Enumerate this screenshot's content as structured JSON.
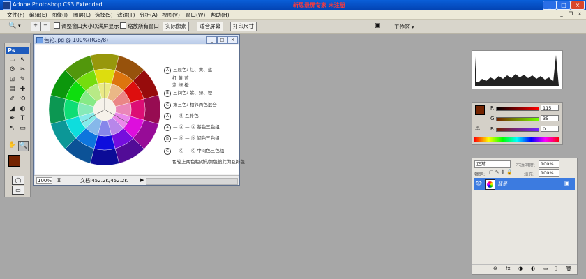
{
  "titlebar": {
    "title": "Adobe Photoshop CS3 Extended",
    "promo": "新思录屏专家 未注册",
    "min": "_",
    "max": "□",
    "close": "×"
  },
  "menu": [
    "文件(F)",
    "编辑(E)",
    "图像(I)",
    "图层(L)",
    "选择(S)",
    "滤镜(T)",
    "分析(A)",
    "视图(V)",
    "窗口(W)",
    "帮助(H)"
  ],
  "options": {
    "zoom_icon": "🔍",
    "dropdown": "▾",
    "resize_window": "调整窗口大小以满屏显示",
    "zoom_all": "缩放所有窗口",
    "actual_pixels": "实际像素",
    "fit_screen": "适合屏幕",
    "print_size": "打印尺寸",
    "workspace": "工作区 ▾"
  },
  "toolbox": {
    "logo": "Ps",
    "tools": [
      "▭",
      "↖",
      "ʘ",
      "✂",
      "⊡",
      "✎",
      "▤",
      "✚",
      "✐",
      "⟲",
      "◢",
      "◐",
      "✒",
      "T",
      "↖",
      "▭",
      "✋",
      "🔍"
    ]
  },
  "document": {
    "title": "色轮.jpg @ 100%(RGB/8)",
    "legend": [
      {
        "key": "A",
        "text": "三原色: 红、黄、蓝"
      },
      {
        "key": "",
        "text": "红  黄  蓝"
      },
      {
        "key": "",
        "text": "紫  绿  橙"
      },
      {
        "key": "B",
        "text": "三间色: 紫、绿、橙"
      },
      {
        "key": "C",
        "text": "第三色: 相邻两色混合"
      },
      {
        "key": "A",
        "text": "— Ⓑ  互补色"
      },
      {
        "key": "A",
        "text": "— Ⓐ — Ⓐ  基色三色组"
      },
      {
        "key": "B",
        "text": "— Ⓑ — Ⓑ  间色三色组"
      },
      {
        "key": "C",
        "text": "— Ⓒ — Ⓒ  中间色三色组"
      },
      {
        "key": "",
        "text": "色轮上两色相对的颜色彼此为互补色"
      }
    ],
    "zoom": "100%",
    "doc_size": "文档:452.2K/452.2K"
  },
  "color_panel": {
    "channels": [
      {
        "label": "R",
        "value": "115"
      },
      {
        "label": "G",
        "value": "35"
      },
      {
        "label": "B",
        "value": "0"
      }
    ],
    "fg_color": "#732300",
    "warning_icon": "⚠"
  },
  "layers_panel": {
    "blend_mode": "正常",
    "opacity_label": "不透明度:",
    "opacity": "100%",
    "lock_label": "锁定:",
    "fill_label": "填充:",
    "fill": "100%",
    "layer_name": "背景",
    "eye_icon": "👁",
    "footer_icons": [
      "⊖",
      "fx",
      "◑",
      "◐",
      "▭",
      "▯",
      "🗑"
    ]
  }
}
